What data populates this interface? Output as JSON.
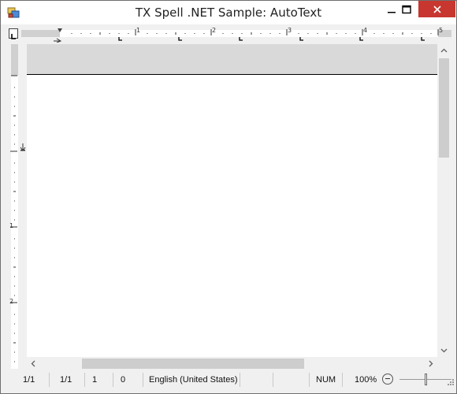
{
  "window": {
    "title": "TX Spell .NET Sample: AutoText",
    "icons": {
      "app": "app-icon",
      "minimize": "minimize-icon",
      "maximize": "maximize-icon",
      "close": "close-icon"
    }
  },
  "ruler": {
    "horizontal_labels": [
      "1",
      "2",
      "3",
      "4",
      "5"
    ],
    "vertical_labels": [
      "1",
      "2"
    ],
    "tab_stop": "L"
  },
  "statusbar": {
    "page": "1/1",
    "section": "1/1",
    "line": "1",
    "column": "0",
    "language": "English (United States)",
    "num": "NUM",
    "zoom": "100%",
    "zoom_value_percent": 100
  },
  "colors": {
    "close_button": "#c7372f",
    "header_area": "#d9d9d9",
    "chrome": "#f0f0f0"
  }
}
